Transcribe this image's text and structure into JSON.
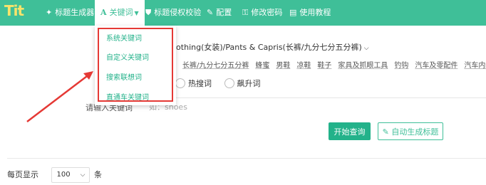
{
  "nav": {
    "logo": "Tit",
    "items": [
      {
        "label": "标题生成器",
        "icon": "magic-wand-icon",
        "glyph": "✦"
      },
      {
        "label": "关键词",
        "icon": "font-a-icon",
        "glyph": "A"
      },
      {
        "label": "标题侵权校验",
        "icon": "shield-icon",
        "glyph": "⛊"
      },
      {
        "label": "配置",
        "icon": "wrench-icon",
        "glyph": "✎"
      },
      {
        "label": "修改密码",
        "icon": "key-icon",
        "glyph": "⚿"
      },
      {
        "label": "使用教程",
        "icon": "book-icon",
        "glyph": "▤"
      }
    ]
  },
  "dropdown": {
    "items": [
      "系统关键词",
      "自定义关键词",
      "搜索联想词",
      "直通车关键词"
    ]
  },
  "category": {
    "path": "lothing(女装)/Pants & Capris(长裤/九分七分五分裤)",
    "tags": [
      "长裤/九分七分五分裤",
      "蜂蜜",
      "男鞋",
      "凉鞋",
      "鞋子",
      "家具及抓眼工具",
      "钓钩",
      "汽车及零配件",
      "汽车内饰用品"
    ]
  },
  "radios": [
    "热搜词",
    "飙升词"
  ],
  "keyword": {
    "label": "请输入关键词",
    "placeholder": "如：shoes"
  },
  "buttons": {
    "query": "开始查询",
    "auto_title": "自动生成标题"
  },
  "pagination": {
    "prefix": "每页显示",
    "value": "100",
    "suffix": "条"
  },
  "colors": {
    "accent": "#3fbf98",
    "highlight": "#e53935"
  }
}
